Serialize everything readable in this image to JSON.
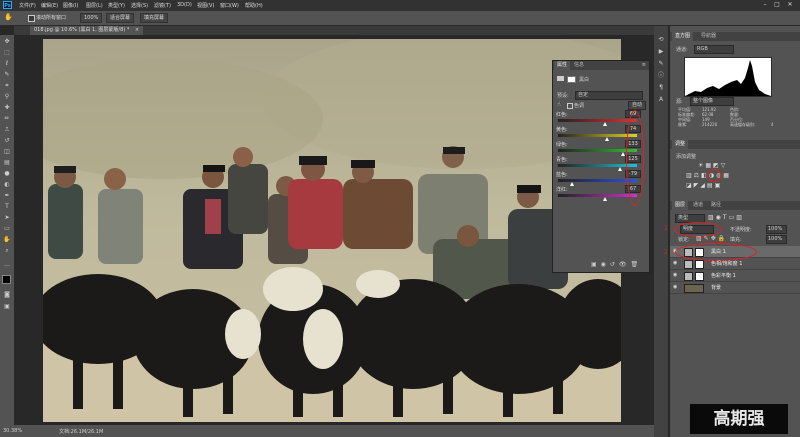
{
  "menubar": {
    "items": [
      "文件(F)",
      "编辑(E)",
      "图像(I)",
      "图层(L)",
      "类型(Y)",
      "选择(S)",
      "滤镜(T)",
      "3D(D)",
      "视图(V)",
      "窗口(W)",
      "帮助(H)"
    ],
    "app_icon": "Ps"
  },
  "optbar": {
    "checkbox_label": "滚动所有窗口",
    "zoom": "100%",
    "fit_screen": "适合屏幕",
    "fill_screen": "填充屏幕"
  },
  "document": {
    "tab_title": "018.jpg @ 10.6% (黑白 1, 图层蒙版/8) *"
  },
  "status": {
    "zoom": "30.38%",
    "doc_size": "文档:26.1M/26.1M"
  },
  "histogram": {
    "tabs": [
      "直方图",
      "导航器"
    ],
    "channel_label": "通道:",
    "channel_value": "RGB",
    "source_label": "源:",
    "source_value": "整个图像",
    "stats_left": [
      "平均值:",
      "标准偏差:",
      "中间值:",
      "像素:"
    ],
    "stats_left_values": [
      "121.92",
      "62.08",
      "149",
      "214220"
    ],
    "stats_right": [
      "色阶:",
      "数量:",
      "百分位:",
      "高速缓存级别:"
    ],
    "stats_right_values": [
      "",
      "",
      "",
      "4"
    ]
  },
  "adjustments": {
    "tab": "调整",
    "add_label": "添加调整"
  },
  "layers_panel": {
    "tabs": [
      "图层",
      "通道",
      "路径"
    ],
    "kind_label": "类型",
    "blend_mode": "明度",
    "opacity_label": "不透明度:",
    "opacity": "100%",
    "lock_label": "锁定:",
    "fill_label": "填充:",
    "fill": "100%",
    "layers": [
      {
        "name": "黑白 1"
      },
      {
        "name": "色相/饱和度 1"
      },
      {
        "name": "色彩平衡 1"
      },
      {
        "name": "背景"
      }
    ]
  },
  "properties": {
    "tabs": [
      "属性",
      "信息"
    ],
    "adj_name": "黑白",
    "preset_label": "预设:",
    "preset_value": "自定",
    "tint_label": "色调",
    "auto_label": "自动",
    "sliders": [
      {
        "label": "红色:",
        "value": "69",
        "pos": 0.6
      },
      {
        "label": "黄色:",
        "value": "74",
        "pos": 0.62
      },
      {
        "label": "绿色:",
        "value": "133",
        "pos": 0.82
      },
      {
        "label": "青色:",
        "value": "125",
        "pos": 0.79
      },
      {
        "label": "蓝色:",
        "value": "-79",
        "pos": 0.18
      },
      {
        "label": "洋红:",
        "value": "67",
        "pos": 0.59
      }
    ]
  },
  "annotations": {
    "num1": "1",
    "num2": "2"
  },
  "watermark": "高期强",
  "colors": {
    "accent_red": "#e02020",
    "panel": "#535353",
    "bar": "#323232"
  }
}
